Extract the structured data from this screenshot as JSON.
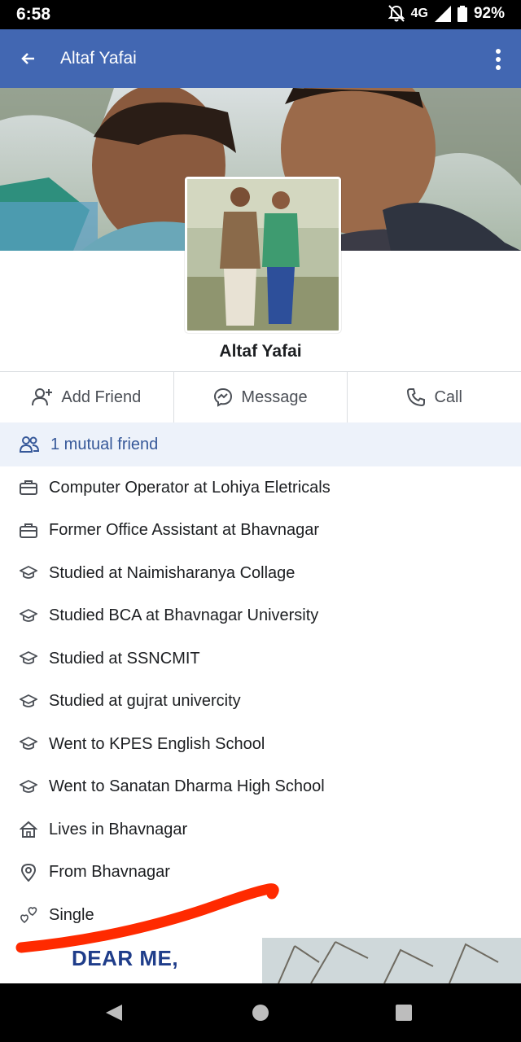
{
  "status_bar": {
    "time": "6:58",
    "network": "4G",
    "battery": "92%"
  },
  "app_bar": {
    "title": "Altaf Yafai",
    "back_icon": "arrow-left-icon",
    "more_icon": "more-vertical-icon"
  },
  "profile": {
    "name": "Altaf Yafai"
  },
  "actions": [
    {
      "label": "Add Friend",
      "icon": "add-friend-icon"
    },
    {
      "label": "Message",
      "icon": "messenger-icon"
    },
    {
      "label": "Call",
      "icon": "phone-icon"
    }
  ],
  "mutual": {
    "label": "1 mutual friend",
    "icon": "people-icon"
  },
  "info": [
    {
      "text": "Computer Operator at Lohiya Eletricals",
      "icon": "briefcase-icon"
    },
    {
      "text": "Former Office Assistant at Bhavnagar",
      "icon": "briefcase-icon"
    },
    {
      "text": "Studied at Naimisharanya Collage",
      "icon": "graduation-cap-icon"
    },
    {
      "text": "Studied BCA at Bhavnagar University",
      "icon": "graduation-cap-icon"
    },
    {
      "text": "Studied at SSNCMIT",
      "icon": "graduation-cap-icon"
    },
    {
      "text": "Studied at gujrat univercity",
      "icon": "graduation-cap-icon"
    },
    {
      "text": "Went to KPES English School",
      "icon": "graduation-cap-icon"
    },
    {
      "text": "Went to Sanatan Dharma High School",
      "icon": "graduation-cap-icon"
    },
    {
      "text": "Lives in Bhavnagar",
      "icon": "home-icon"
    },
    {
      "text": "From Bhavnagar",
      "icon": "location-pin-icon"
    },
    {
      "text": "Single",
      "icon": "hearts-icon"
    }
  ],
  "teaser": {
    "text": "DEAR ME,"
  },
  "colors": {
    "app_bar": "#4267b2",
    "link_blue": "#365899",
    "mutual_bg": "#edf2fa",
    "scribble": "#ff2a00"
  }
}
